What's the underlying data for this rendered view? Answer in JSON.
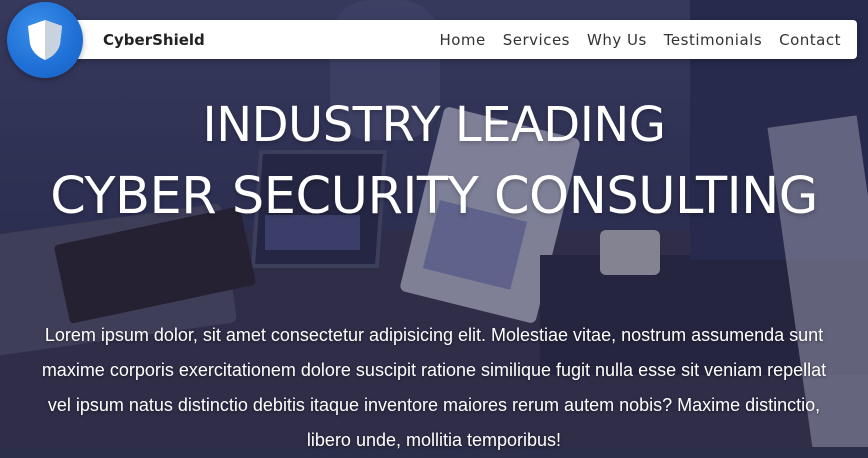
{
  "brand": {
    "name": "CyberShield",
    "logo_icon": "shield-icon"
  },
  "nav": {
    "items": [
      {
        "label": "Home"
      },
      {
        "label": "Services"
      },
      {
        "label": "Why Us"
      },
      {
        "label": "Testimonials"
      },
      {
        "label": "Contact"
      }
    ]
  },
  "hero": {
    "title_line1": "INDUSTRY LEADING",
    "title_line2": "CYBER SECURITY CONSULTING",
    "body": "Lorem ipsum dolor, sit amet consectetur adipisicing elit. Molestiae vitae, nostrum assumenda sunt maxime corporis exercitationem dolore suscipit ratione similique fugit nulla esse sit veniam repellat vel ipsum natus distinctio debitis itaque inventore maiores rerum autem nobis? Maxime distinctio, libero unde, mollitia temporibus!"
  },
  "colors": {
    "accent": "#1e6fd6",
    "overlay": "#1e2046",
    "navbar_bg": "#ffffff",
    "text_light": "#ffffff"
  }
}
